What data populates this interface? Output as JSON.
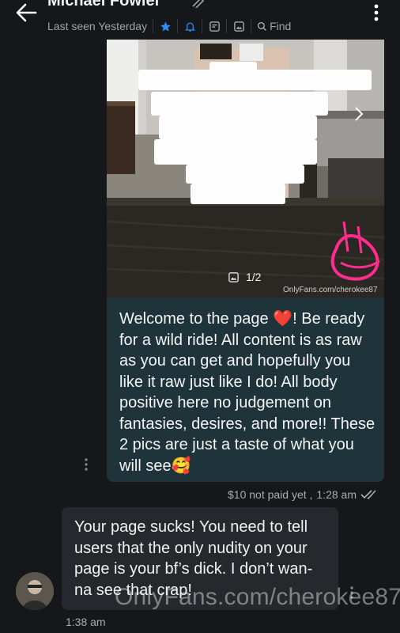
{
  "header": {
    "contact_name": "Michael Fowler",
    "last_seen": "Last seen Yesterday",
    "find_label": "Find",
    "icons": [
      "back-arrow-icon",
      "edit-pencil-icon",
      "star-icon",
      "bell-icon",
      "note-icon",
      "image-icon",
      "search-icon",
      "kebab-menu-icon"
    ]
  },
  "sent_media": {
    "counter": "1/2",
    "watermark": "OnlyFans.com/cherokee87"
  },
  "sent_message": {
    "text_before_heart": "Welcome to the page ",
    "heart": "❤️",
    "text_after_heart": "! Be ready for a wild ride! All content is as raw as you can get and hopefully you like it raw just like I do! All body positive here no judgement on fantasies, desires, and more!! These 2 pics are just a taste of what you will see",
    "end_emoji": "🥰",
    "price_status": "$10 not paid yet ,",
    "time": "1:28 am"
  },
  "received_message": {
    "text": "Your page sucks! You need to tell users that the only nudity on your page is your bf’s dick. I don’t wan-na see that crap!",
    "time": "1:38 am"
  },
  "overlay_watermark": "OnlyFans.com/cherokee87",
  "colors": {
    "background": "#16171b",
    "sent_bubble": "#1f333a",
    "received_bubble": "#27282d",
    "accent_blue": "#2f8ff1"
  }
}
